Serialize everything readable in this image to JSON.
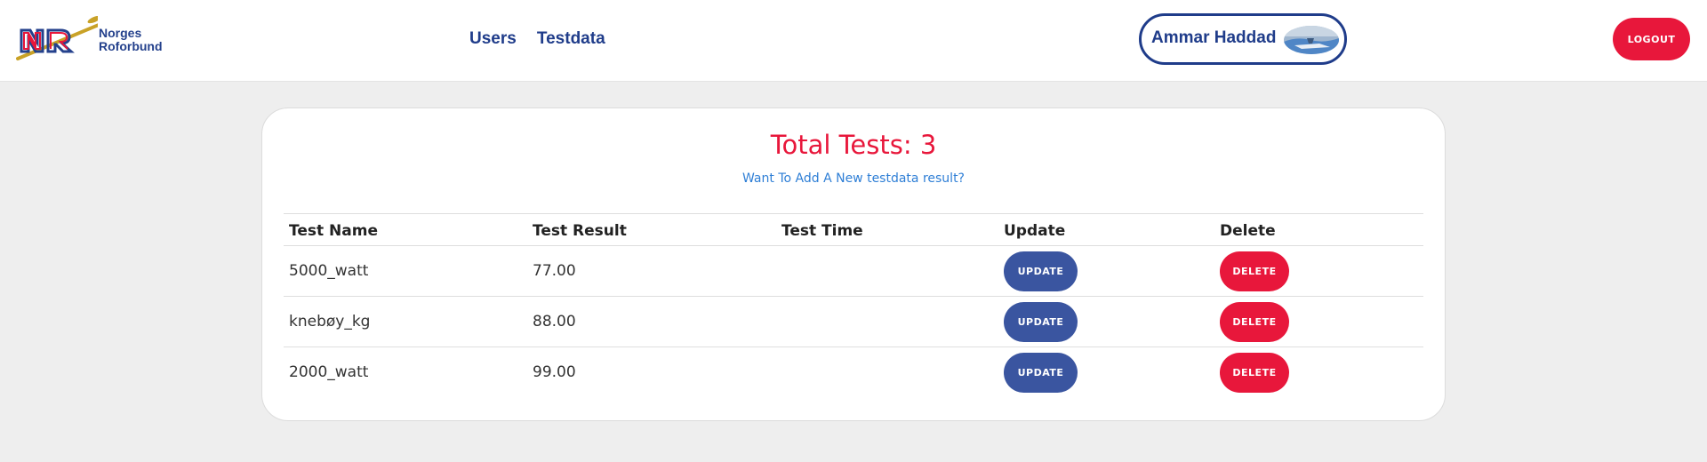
{
  "brand": {
    "line1": "Norges",
    "line2": "Roforbund"
  },
  "nav": {
    "links": [
      {
        "label": "Users"
      },
      {
        "label": "Testdata"
      }
    ]
  },
  "user": {
    "name": "Ammar Haddad"
  },
  "header": {
    "logout_label": "LOGOUT"
  },
  "main": {
    "title": "Total Tests: 3",
    "add_link": "Want To Add A New testdata result?",
    "table": {
      "headers": [
        "Test Name",
        "Test Result",
        "Test Time",
        "Update",
        "Delete"
      ],
      "rows": [
        {
          "name": "5000_watt",
          "result": "77.00",
          "time": "",
          "update_label": "UPDATE",
          "delete_label": "DELETE"
        },
        {
          "name": "knebøy_kg",
          "result": "88.00",
          "time": "",
          "update_label": "UPDATE",
          "delete_label": "DELETE"
        },
        {
          "name": "2000_watt",
          "result": "99.00",
          "time": "",
          "update_label": "UPDATE",
          "delete_label": "DELETE"
        }
      ]
    }
  },
  "colors": {
    "primary": "#1f3c8a",
    "accent": "#e8173b",
    "button_blue": "#3a55a0",
    "link": "#2f7fd6"
  }
}
